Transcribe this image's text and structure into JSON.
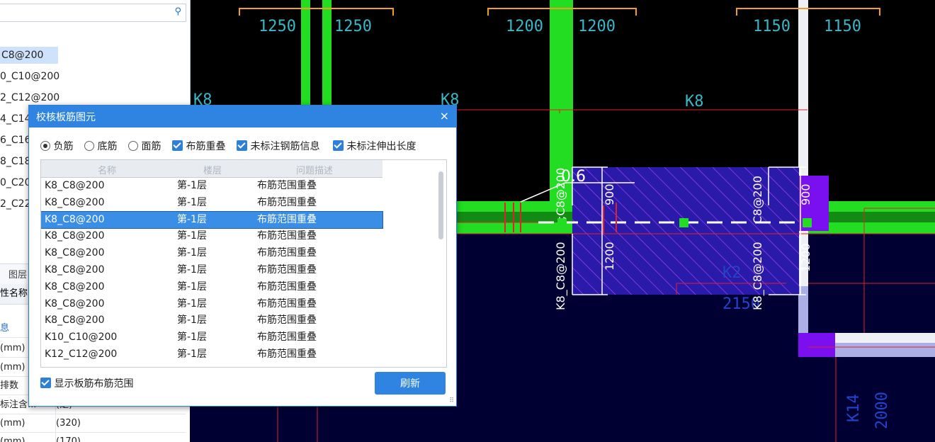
{
  "left_panel": {
    "tree_items": [
      {
        "label": "C8@200",
        "selected": true
      },
      {
        "label": "0_C10@200",
        "selected": false
      },
      {
        "label": "2_C12@200",
        "selected": false
      },
      {
        "label": "4_C14",
        "selected": false
      },
      {
        "label": "6_C16",
        "selected": false
      },
      {
        "label": "8_C18",
        "selected": false
      },
      {
        "label": "0_C20",
        "selected": false
      },
      {
        "label": "2_C22",
        "selected": false
      }
    ],
    "tab_label": "图层",
    "prop_header": "性名称",
    "prop_rows": [
      {
        "key": "息",
        "value": ""
      },
      {
        "key": "(mm)",
        "value": ""
      },
      {
        "key": "(mm)",
        "value": ""
      },
      {
        "key": "排数",
        "value": ""
      },
      {
        "key": "标注含...",
        "value": "(是)"
      },
      {
        "key": "(mm)",
        "value": "(320)"
      },
      {
        "key": "(mm)",
        "value": "(170)"
      }
    ]
  },
  "canvas": {
    "top_dims": [
      "1250",
      "1250",
      "1200",
      "1200",
      "1150",
      "1150"
    ],
    "k8_labels": [
      "K8",
      "K8",
      "K8"
    ],
    "label_06": "0.6",
    "label_900a": "900",
    "label_900b": "900",
    "label_1200a": "1200",
    "label_1200b": "1200",
    "label_vert1": "K8_C8@200",
    "label_vert2": "K8_C8@200",
    "label_partial1": ";C8@200",
    "label_partial2": "C8@200",
    "label_k2": "K2",
    "label_2150": "2150",
    "label_k14": "K14",
    "label_2000": "2000"
  },
  "dialog": {
    "title": "校核板筋图元",
    "close": "×",
    "options": {
      "neg": "负筋",
      "bottom": "底筋",
      "top": "面筋",
      "overlap": "布筋重叠",
      "unmarked_info": "未标注钢筋信息",
      "unmarked_len": "未标注伸出长度"
    },
    "columns": [
      "名称",
      "楼层",
      "问题描述"
    ],
    "rows": [
      {
        "name": "K8_C8@200",
        "floor": "第-1层",
        "desc": "布筋范围重叠"
      },
      {
        "name": "K8_C8@200",
        "floor": "第-1层",
        "desc": "布筋范围重叠"
      },
      {
        "name": "K8_C8@200",
        "floor": "第-1层",
        "desc": "布筋范围重叠"
      },
      {
        "name": "K8_C8@200",
        "floor": "第-1层",
        "desc": "布筋范围重叠"
      },
      {
        "name": "K8_C8@200",
        "floor": "第-1层",
        "desc": "布筋范围重叠"
      },
      {
        "name": "K8_C8@200",
        "floor": "第-1层",
        "desc": "布筋范围重叠"
      },
      {
        "name": "K8_C8@200",
        "floor": "第-1层",
        "desc": "布筋范围重叠"
      },
      {
        "name": "K8_C8@200",
        "floor": "第-1层",
        "desc": "布筋范围重叠"
      },
      {
        "name": "K8_C8@200",
        "floor": "第-1层",
        "desc": "布筋范围重叠"
      },
      {
        "name": "K10_C10@200",
        "floor": "第-1层",
        "desc": "布筋范围重叠"
      },
      {
        "name": "K12_C12@200",
        "floor": "第-1层",
        "desc": "布筋范围重叠"
      }
    ],
    "selected_row": 2,
    "show_range": "显示板筋布筋范围",
    "refresh": "刷新"
  },
  "colors": {
    "accent": "#2e84e0",
    "beam_green": "#22dd22",
    "slab_navy": "#000033",
    "hatch_purple": "#3a22cc",
    "dim_cyan": "#3ab8c8"
  }
}
